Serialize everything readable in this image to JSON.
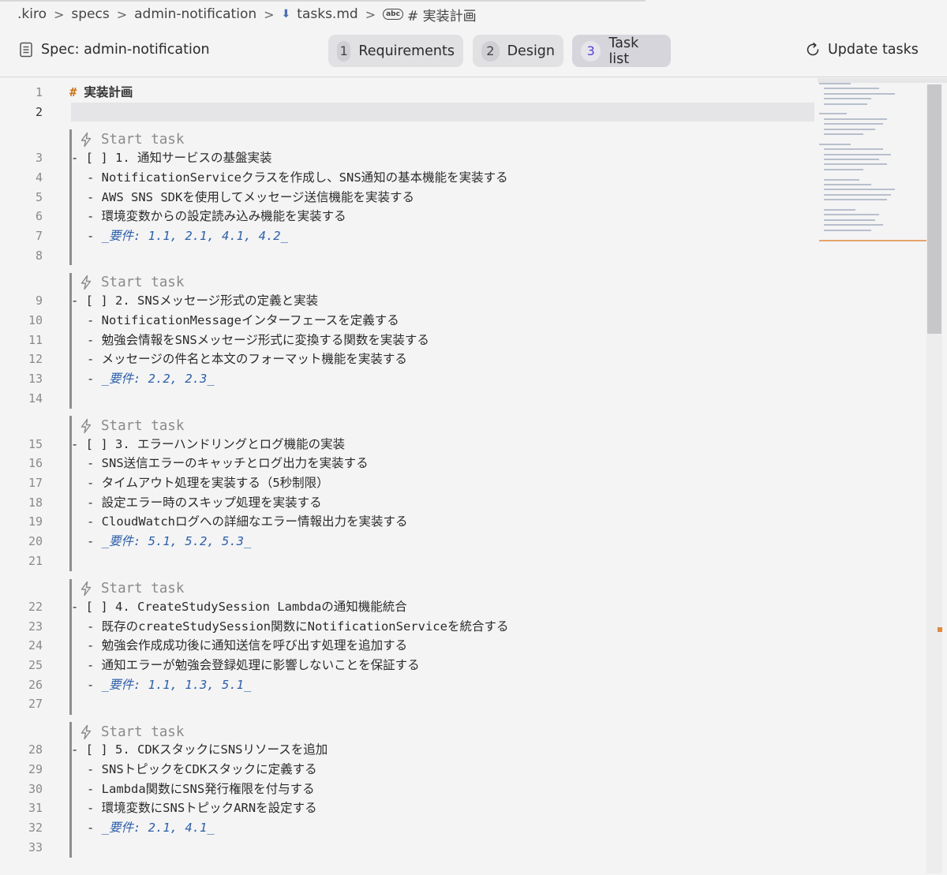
{
  "breadcrumb": {
    "items": [
      ".kiro",
      "specs",
      "admin-notification",
      "tasks.md",
      "# 実装計画"
    ],
    "separator": ">"
  },
  "header": {
    "spec_label": "Spec: admin-notification",
    "tabs": [
      {
        "num": "1",
        "label": "Requirements"
      },
      {
        "num": "2",
        "label": "Design"
      },
      {
        "num": "3",
        "label": "Task list",
        "active": true
      }
    ],
    "update_label": "Update tasks"
  },
  "editor": {
    "codelens_label": "Start task",
    "lines": {
      "1": "実装計画",
      "3": "- [ ] 1. 通知サービスの基盤実装",
      "4": "- NotificationServiceクラスを作成し、SNS通知の基本機能を実装する",
      "5": "- AWS SNS SDKを使用してメッセージ送信機能を実装する",
      "6": "- 環境変数からの設定読み込み機能を実装する",
      "7": "_要件: 1.1, 2.1, 4.1, 4.2_",
      "9": "- [ ] 2. SNSメッセージ形式の定義と実装",
      "10": "- NotificationMessageインターフェースを定義する",
      "11": "- 勉強会情報をSNSメッセージ形式に変換する関数を実装する",
      "12": "- メッセージの件名と本文のフォーマット機能を実装する",
      "13": "_要件: 2.2, 2.3_",
      "15": "- [ ] 3. エラーハンドリングとログ機能の実装",
      "16": "- SNS送信エラーのキャッチとログ出力を実装する",
      "17": "- タイムアウト処理を実装する（5秒制限）",
      "18": "- 設定エラー時のスキップ処理を実装する",
      "19": "- CloudWatchログへの詳細なエラー情報出力を実装する",
      "20": "_要件: 5.1, 5.2, 5.3_",
      "22": "- [ ] 4. CreateStudySession Lambdaの通知機能統合",
      "23": "- 既存のcreateStudySession関数にNotificationServiceを統合する",
      "24": "- 勉強会作成成功後に通知送信を呼び出す処理を追加する",
      "25": "- 通知エラーが勉強会登録処理に影響しないことを保証する",
      "26": "_要件: 1.1, 1.3, 5.1_",
      "28": "- [ ] 5. CDKスタックにSNSリソースを追加",
      "29": "- SNSトピックをCDKスタックに定義する",
      "30": "- Lambda関数にSNS発行権限を付与する",
      "31": "- 環境変数にSNSトピックARNを設定する",
      "32": "_要件: 2.1, 4.1_"
    },
    "line_count": 33,
    "current_line": 2
  },
  "colors": {
    "accent": "#5a3fd6",
    "heading_hash": "#c9771c",
    "requirement": "#2d5fa8"
  }
}
